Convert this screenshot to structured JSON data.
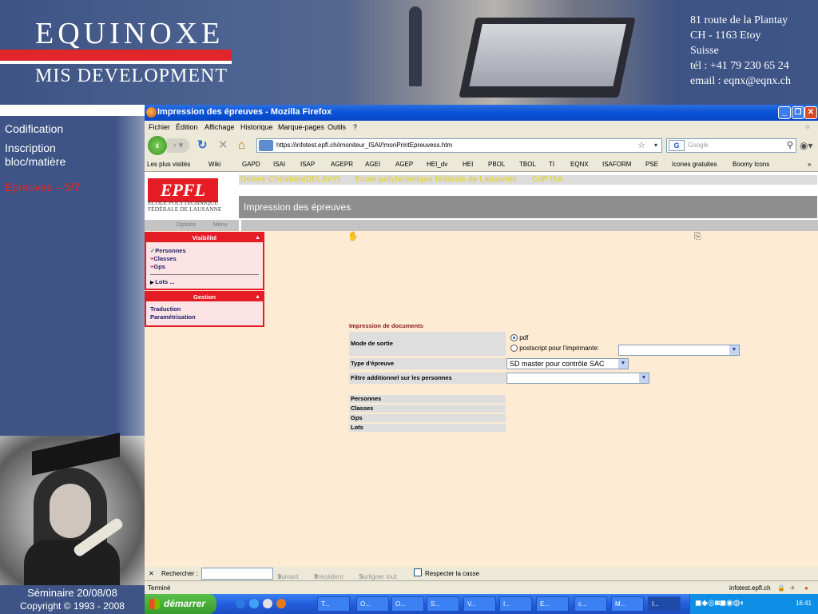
{
  "banner": {
    "logo_line1": "EQUINOXE",
    "logo_line2": "MIS DEVELOPMENT",
    "address": [
      "81 route de la Plantay",
      "CH - 1163 Etoy",
      "Suisse",
      "tél : +41 79 230 65 24",
      "email : eqnx@eqnx.ch"
    ]
  },
  "slide_nav": {
    "items": [
      "Codification",
      "Inscription bloc/matière",
      "Epreuves – 5/7"
    ],
    "active_index": 2,
    "active_color": "#ff1e1e"
  },
  "footer": {
    "line1": "Séminaire 20/08/08",
    "line2": "Copyright © 1993 - 2008"
  },
  "browser": {
    "title": "Impression des épreuves - Mozilla Firefox",
    "menu": [
      "Fichier",
      "Édition",
      "Affichage",
      "Historique",
      "Marque-pages",
      "Outils",
      "?"
    ],
    "url": "https://infotest.epfl.ch/imoniteur_ISAI/!monPrintEpreuvess.htm",
    "search_placeholder": "Google",
    "search_engine_letter": "G",
    "bookmarks": [
      "Les plus visités",
      "Wiki",
      "GAPD",
      "ISAI",
      "ISAP",
      "AGEPR",
      "AGEI",
      "AGEP",
      "HEI_dv",
      "HEI",
      "PBOL",
      "TBOL",
      "TI",
      "EQNX",
      "ISAFORM",
      "PSE",
      "Icones gratuites",
      "Boomy Icons",
      "»"
    ]
  },
  "page": {
    "logo_text": "EPFL",
    "school_name": [
      "ÉCOLE POLYTECHNIQUE",
      "FÉDÉRALE DE LAUSANNE"
    ],
    "user": "Delavy Christian(DELAVY)",
    "school": "Ecole polytechnique fédérale de Lausanne",
    "role": "CdP ISA",
    "title": "Impression des épreuves",
    "tabs": [
      "Options",
      "Menu"
    ],
    "visibility": {
      "header": "Visibilité",
      "items": [
        {
          "mark": "✓",
          "label": "Personnes"
        },
        {
          "mark": "+",
          "label": "Classes"
        },
        {
          "mark": "+",
          "label": "Gps"
        }
      ],
      "lots": "Lots ..."
    },
    "gestion": {
      "header": "Gestion",
      "items": [
        "Traduction",
        "Paramétrisation"
      ]
    },
    "form": {
      "section_title": "Impression de documents",
      "mode_label": "Mode de sortie",
      "mode_options": [
        "pdf",
        "postscript pour l'imprimante:"
      ],
      "mode_selected": "pdf",
      "printer_value": "",
      "type_label": "Type d'épreuve",
      "type_value": "SD master pour contrôle SAC",
      "filter_label": "Filtre additionnel sur les personnes",
      "filter_value": ""
    },
    "lists": [
      "Personnes",
      "Classes",
      "Gps",
      "Lots"
    ]
  },
  "findbar": {
    "close": "✕",
    "label": "Rechercher :",
    "next": "Suivant",
    "previous": "Précédent",
    "highlight": "Surligner tout",
    "match_case": "Respecter la casse"
  },
  "status": {
    "left": "Terminé",
    "right": "infotest.epfl.ch"
  },
  "taskbar": {
    "start": "démarrer",
    "tasks": [
      "T...",
      "O...",
      "O...",
      "S...",
      "V...",
      "I...",
      "E...",
      "c...",
      "M...",
      "I..."
    ],
    "active_task_index": 9,
    "clock": "16:41"
  }
}
